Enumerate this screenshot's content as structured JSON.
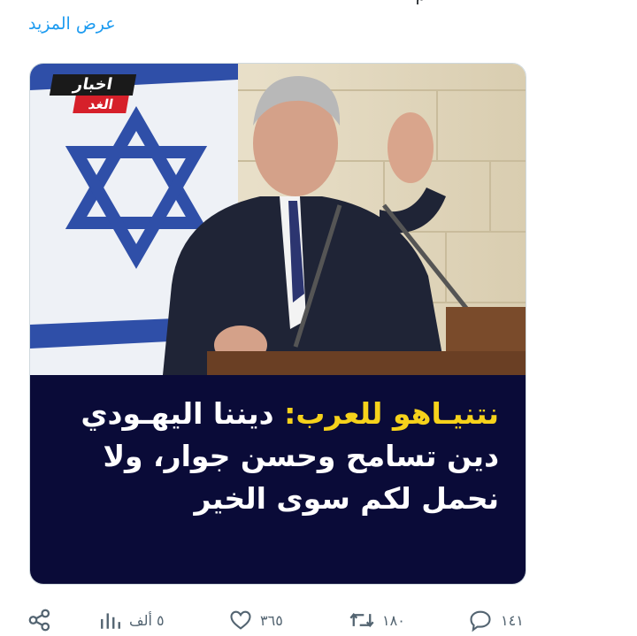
{
  "top_fragment": "م",
  "show_more": "عرض المزيد",
  "media": {
    "brand_line1": "اخبار",
    "brand_line2": "الغد",
    "caption_highlight": "نتنيـاهو للعرب:",
    "caption_rest": "ديننا اليهـودي دين تسامح وحسن جوار، ولا نحمل لكم سوى الخير",
    "colors": {
      "panel": "#0a0b38",
      "highlight": "#f6d21b",
      "brand_red": "#d6202a"
    }
  },
  "actions": {
    "views": "٥ ألف",
    "likes": "٣٦٥",
    "retweets": "١٨٠",
    "replies": "١٤١",
    "icons": [
      "share-icon",
      "views-icon",
      "like-icon",
      "retweet-icon",
      "reply-icon"
    ]
  }
}
